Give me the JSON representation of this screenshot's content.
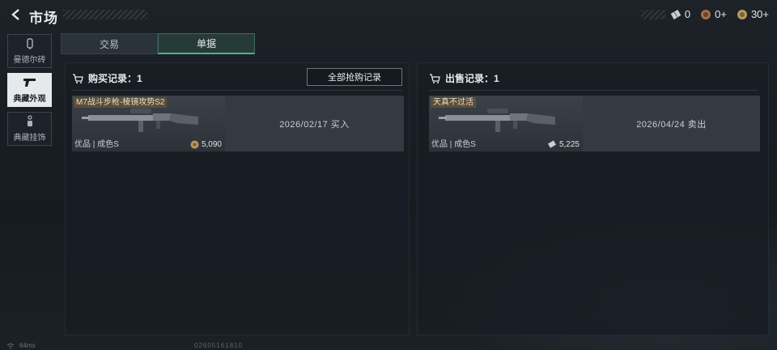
{
  "header": {
    "title": "市场",
    "currencies": [
      {
        "icon": "ticket-icon",
        "value": "0"
      },
      {
        "icon": "coin-brown-icon",
        "value": "0+"
      },
      {
        "icon": "coin-gold-icon",
        "value": "30+"
      }
    ]
  },
  "sidebar": {
    "items": [
      {
        "label": "曼德尔砖",
        "icon": "brick-icon",
        "active": false
      },
      {
        "label": "典藏外观",
        "icon": "pistol-icon",
        "active": true
      },
      {
        "label": "典藏挂饰",
        "icon": "charm-icon",
        "active": false
      }
    ]
  },
  "tabs": [
    {
      "label": "交易",
      "active": false
    },
    {
      "label": "单据",
      "active": true
    }
  ],
  "purchase": {
    "title": "购买记录：1",
    "all_button": "全部抢购记录",
    "record": {
      "item_name": "M7战斗步枪-棱镜攻势S2",
      "quality": "优品 | 成色S",
      "price": "5,090",
      "price_icon": "coin-icon",
      "info": "2026/02/17 买入"
    }
  },
  "sale": {
    "title": "出售记录：1",
    "record": {
      "item_name": "天真不过活",
      "quality": "优品 | 成色S",
      "price": "5,225",
      "price_icon": "ticket-icon",
      "info": "2026/04/24 卖出"
    }
  },
  "footer": {
    "ping": "64ms",
    "uid": "02605161810"
  },
  "colors": {
    "accent": "#4fb08a",
    "tag_bg": "#785a32"
  }
}
